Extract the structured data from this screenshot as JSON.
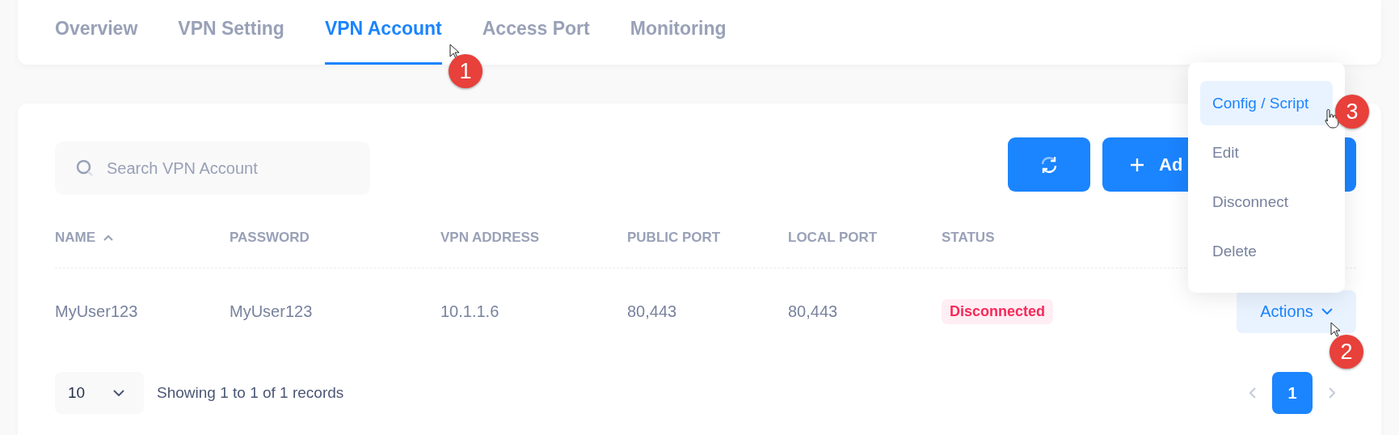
{
  "tabs": [
    {
      "label": "Overview",
      "selected": false
    },
    {
      "label": "VPN Setting",
      "selected": false
    },
    {
      "label": "VPN Account",
      "selected": true
    },
    {
      "label": "Access Port",
      "selected": false
    },
    {
      "label": "Monitoring",
      "selected": false
    }
  ],
  "search": {
    "placeholder": "Search VPN Account"
  },
  "add_button": {
    "label": "Ad"
  },
  "table": {
    "columns": [
      {
        "label": "NAME",
        "sorted": true
      },
      {
        "label": "PASSWORD",
        "sorted": false
      },
      {
        "label": "VPN ADDRESS",
        "sorted": false
      },
      {
        "label": "PUBLIC PORT",
        "sorted": false
      },
      {
        "label": "LOCAL PORT",
        "sorted": false
      },
      {
        "label": "STATUS",
        "sorted": false
      }
    ],
    "rows": [
      {
        "cells": [
          "MyUser123",
          "MyUser123",
          "10.1.1.6",
          "80,443",
          "80,443"
        ],
        "status": {
          "label": "Disconnected",
          "kind": "danger"
        },
        "action": "Actions"
      }
    ]
  },
  "menu": {
    "items": [
      {
        "label": "Config / Script",
        "selected": true
      },
      {
        "label": "Edit",
        "selected": false
      },
      {
        "label": "Disconnect",
        "selected": false
      },
      {
        "label": "Delete",
        "selected": false
      }
    ]
  },
  "footer": {
    "page_size": "10",
    "summary": "Showing 1 to 1 of 1 records",
    "pages": [
      {
        "label": "1",
        "selected": true
      }
    ]
  },
  "annotations": [
    {
      "label": "1"
    },
    {
      "label": "3"
    },
    {
      "label": "2"
    }
  ]
}
